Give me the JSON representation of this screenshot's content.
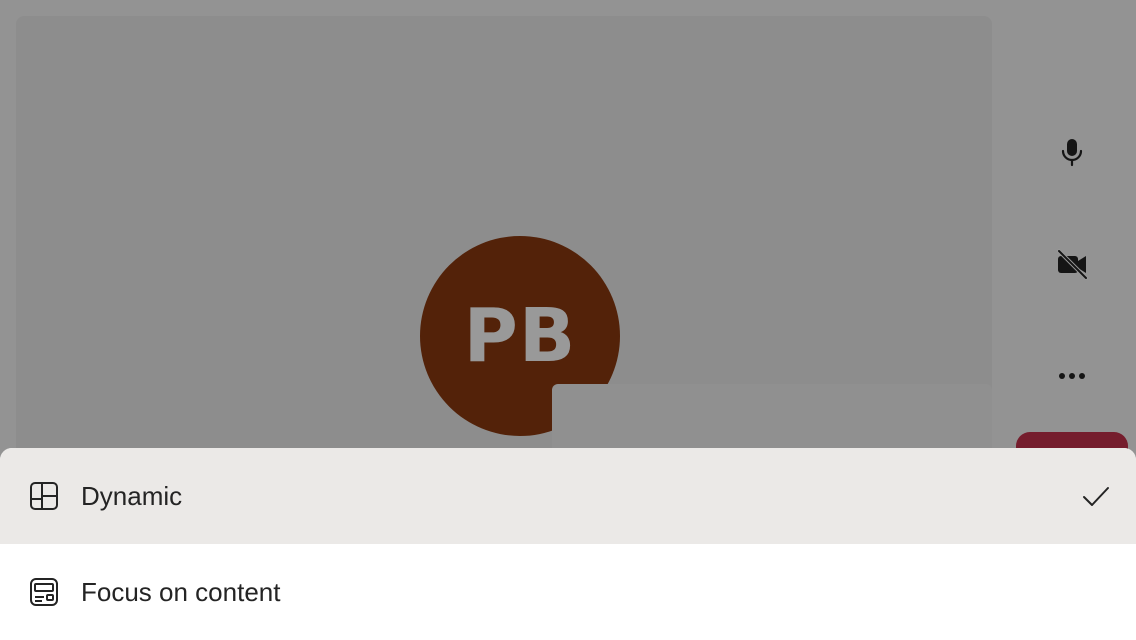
{
  "participant": {
    "initials": "PB",
    "avatar_color": "#8a3a10"
  },
  "controls": {
    "mic_icon": "microphone-icon",
    "camera_icon": "camera-off-icon",
    "more_icon": "more-options-icon",
    "leave_color": "#c4314b"
  },
  "layout_menu": {
    "items": [
      {
        "label": "Dynamic",
        "icon": "dynamic-layout-icon",
        "selected": true
      },
      {
        "label": "Focus on content",
        "icon": "focus-content-icon",
        "selected": false
      }
    ]
  }
}
